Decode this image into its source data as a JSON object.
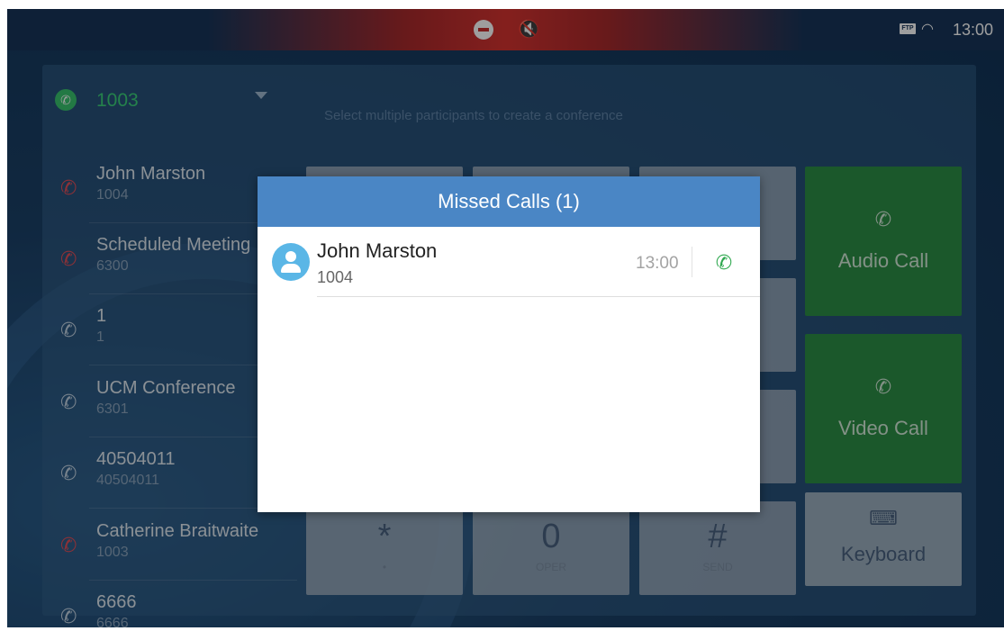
{
  "status_bar": {
    "time": "13:00",
    "ftp_label": "FTP",
    "icons": [
      "do-not-disturb-icon",
      "mute-icon",
      "ftp-icon",
      "wifi-icon"
    ]
  },
  "account": {
    "number": "1003",
    "status_color": "#39c36e"
  },
  "hint": "Select multiple participants to create a conference",
  "history": [
    {
      "name": "John Marston",
      "number": "1004",
      "type": "missed"
    },
    {
      "name": "Scheduled Meeting",
      "number": "6300",
      "type": "missed"
    },
    {
      "name": "1",
      "number": "1",
      "type": "outgoing"
    },
    {
      "name": "UCM Conference",
      "number": "6301",
      "type": "outgoing"
    },
    {
      "name": "40504011",
      "number": "40504011",
      "type": "outgoing"
    },
    {
      "name": "Catherine Braitwaite",
      "number": "1003",
      "type": "missed"
    },
    {
      "name": "6666",
      "number": "6666",
      "type": "outgoing"
    }
  ],
  "dialpad": {
    "star": {
      "main": "*",
      "sub": "•"
    },
    "zero": {
      "main": "0",
      "sub": "OPER"
    },
    "hash": {
      "main": "#",
      "sub": "SEND"
    }
  },
  "actions": {
    "audio_call": "Audio Call",
    "video_call": "Video Call",
    "keyboard": "Keyboard"
  },
  "dialog": {
    "title": "Missed Calls (1)",
    "items": [
      {
        "name": "John Marston",
        "number": "1004",
        "time": "13:00"
      }
    ],
    "accent_color": "#4a86c5"
  }
}
